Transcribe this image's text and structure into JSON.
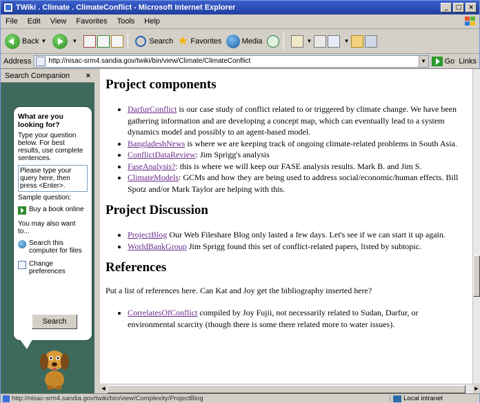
{
  "window": {
    "title": "TWiki . Climate . ClimateConflict - Microsoft Internet Explorer",
    "controls": [
      "_",
      "□",
      "×"
    ]
  },
  "menu": [
    "File",
    "Edit",
    "View",
    "Favorites",
    "Tools",
    "Help"
  ],
  "toolbar": {
    "back": "Back",
    "search": "Search",
    "favorites": "Favorites",
    "media": "Media"
  },
  "address": {
    "label": "Address",
    "url": "http://nisac-srm4.sandia.gov/twiki/bin/view/Climate/ClimateConflict",
    "go": "Go",
    "links": "Links"
  },
  "sidebar": {
    "header": "Search Companion",
    "close": "×",
    "question": "What are you looking for?",
    "instructions": "Type your question below. For best results, use complete sentences.",
    "query_placeholder": "Please type your query here, then press <Enter>.",
    "sample_label": "Sample question:",
    "sample": "Buy a book online",
    "also_label": "You may also want to...",
    "options": [
      "Search this computer for files",
      "Change preferences"
    ],
    "search_button": "Search"
  },
  "content": {
    "h_components": "Project components",
    "components": [
      {
        "link": "DarfurConflict",
        "text": " is our case study of conflict related to or triggered by climate change. We have been gathering information and are developing a concept map, which can eventually lead to a system dynamics model and possibly to an agent-based model."
      },
      {
        "link": "BangladeshNews",
        "text": " is where we are keeping track of ongoing climate-related problems in South Asia."
      },
      {
        "link": "ConflictDataReview",
        "text": ": Jim Sprigg's analysis"
      },
      {
        "link": "FaseAnalysis?",
        "text": ": this is where we will keep our FASE analysis results. Mark B. and Jim S."
      },
      {
        "link": "ClimateModels",
        "text": ": GCMs and how they are being used to address social/economic/human effects. Bill Spotz and/or Mark Taylor are helping with this."
      }
    ],
    "h_discussion": "Project Discussion",
    "discussion": [
      {
        "link": "ProjectBlog",
        "text": " Our Web Fileshare Blog only lasted a few days. Let's see if we can start it up again."
      },
      {
        "link": "WorldBankGroup",
        "text": " Jim Sprigg found this set of conflict-related papers, listed by subtopic."
      }
    ],
    "h_references": "References",
    "references_intro": "Put a list of references here. Can Kat and Joy get the bibliography inserted here?",
    "references": [
      {
        "link": "CorrelatesOfConflict",
        "text": " compiled by Joy Fujii, not necessarily related to Sudan, Darfur, or environmental scarcity (though there is some there related more to water issues)."
      }
    ]
  },
  "status": {
    "url": "http://nisac-srm4.sandia.gov/twiki/bin/view/Complexity/ProjectBlog",
    "zone": "Local intranet"
  }
}
